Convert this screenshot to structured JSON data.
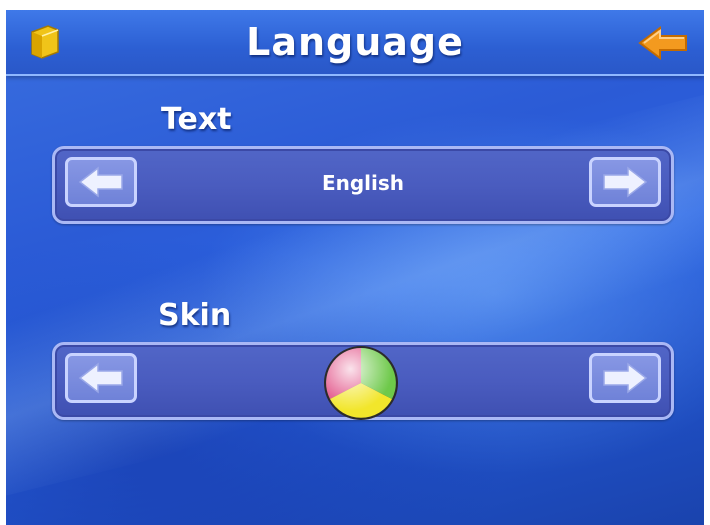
{
  "header": {
    "title": "Language",
    "app_icon": "folder-icon",
    "back_icon": "back-arrow-icon"
  },
  "text_setting": {
    "label": "Text",
    "value": "English",
    "prev_icon": "arrow-left-icon",
    "next_icon": "arrow-right-icon"
  },
  "skin_setting": {
    "label": "Skin",
    "preview_icon": "skin-color-ball-icon",
    "prev_icon": "arrow-left-icon",
    "next_icon": "arrow-right-icon"
  },
  "colors": {
    "background": "#2b5bd6",
    "panel": "#4a5cbf",
    "accent_orange": "#f39a1f",
    "text": "#ffffff"
  }
}
